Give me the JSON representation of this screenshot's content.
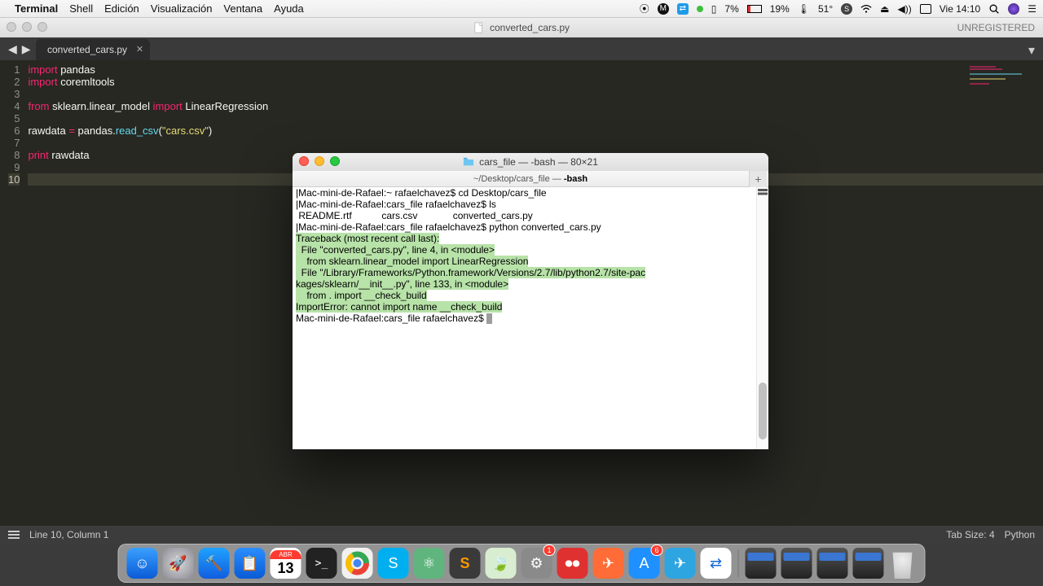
{
  "menubar": {
    "app": "Terminal",
    "items": [
      "Shell",
      "Edición",
      "Visualización",
      "Ventana",
      "Ayuda"
    ],
    "right": {
      "cpu": "7%",
      "battery": "19%",
      "temp": "51°",
      "clock": "Vie 14:10"
    }
  },
  "sublime": {
    "title_file": "converted_cars.py",
    "unregistered": "UNREGISTERED",
    "tab": "converted_cars.py",
    "lines": [
      "1",
      "2",
      "3",
      "4",
      "5",
      "6",
      "7",
      "8",
      "9",
      "10"
    ],
    "cursor_line": "10",
    "code": {
      "l1_kw": "import",
      "l1_rest": " pandas",
      "l2_kw": "import",
      "l2_rest": " coremltools",
      "l4_from": "from",
      "l4_mod": " sklearn.linear_model ",
      "l4_imp": "import",
      "l4_rest": " LinearRegression",
      "l6_a": "rawdata ",
      "l6_eq": "=",
      "l6_b": " pandas.",
      "l6_fn": "read_csv",
      "l6_p1": "(",
      "l6_str": "\"cars.csv\"",
      "l6_p2": ")",
      "l8_kw": "print",
      "l8_rest": " rawdata"
    },
    "status": {
      "pos": "Line 10, Column 1",
      "tabsize": "Tab Size: 4",
      "syntax": "Python"
    }
  },
  "terminal": {
    "title": "cars_file — -bash — 80×21",
    "pathbar_a": "~/Desktop/cars_file — ",
    "pathbar_b": "-bash",
    "lines": [
      "|Mac-mini-de-Rafael:~ rafaelchavez$ cd Desktop/cars_file",
      "|Mac-mini-de-Rafael:cars_file rafaelchavez$ ls",
      " README.rtf           cars.csv             converted_cars.py",
      "|Mac-mini-de-Rafael:cars_file rafaelchavez$ python converted_cars.py"
    ],
    "err": [
      "Traceback (most recent call last):",
      "  File \"converted_cars.py\", line 4, in <module>",
      "    from sklearn.linear_model import LinearRegression",
      "  File \"/Library/Frameworks/Python.framework/Versions/2.7/lib/python2.7/site-pac",
      "kages/sklearn/__init__.py\", line 133, in <module>",
      "    from . import __check_build",
      "ImportError: cannot import name __check_build"
    ],
    "prompt": "Mac-mini-de-Rafael:cars_file rafaelchavez$ "
  },
  "dock": {
    "apps": [
      {
        "name": "finder",
        "bg": "linear-gradient(#3aa0ff,#0a5bd6)",
        "glyph": "☺"
      },
      {
        "name": "launchpad",
        "bg": "radial-gradient(#d7d7d7,#8a8a95)",
        "glyph": "🚀"
      },
      {
        "name": "xcode",
        "bg": "linear-gradient(#1fa2ff,#115ddf)",
        "glyph": "🔨"
      },
      {
        "name": "trello",
        "bg": "linear-gradient(#2b8eff,#0a5bd6)",
        "glyph": "📋"
      },
      {
        "name": "calendar",
        "bg": "#fff",
        "glyph": "",
        "cal": "13",
        "month": "ABR"
      },
      {
        "name": "terminal",
        "bg": "#222",
        "glyph": ">_"
      },
      {
        "name": "chrome",
        "bg": "#f1f1f1",
        "glyph": "◉",
        "ring": true
      },
      {
        "name": "skype",
        "bg": "#00aff0",
        "glyph": "S"
      },
      {
        "name": "atom",
        "bg": "#5fb57d",
        "glyph": "⚛"
      },
      {
        "name": "sublime",
        "bg": "#3a3a3a",
        "glyph": "S",
        "accent": "#ff9900"
      },
      {
        "name": "mongodb",
        "bg": "#d9edd0",
        "glyph": "🍃"
      },
      {
        "name": "settings",
        "bg": "#8a8a8a",
        "glyph": "⚙",
        "badge": "1"
      },
      {
        "name": "recorder",
        "bg": "#e03131",
        "glyph": "⏺⏺"
      },
      {
        "name": "postman",
        "bg": "#ff6c37",
        "glyph": "✈"
      },
      {
        "name": "appstore",
        "bg": "#1e90ff",
        "glyph": "A",
        "badge": "6"
      },
      {
        "name": "telegram",
        "bg": "#2da5e1",
        "glyph": "✈"
      },
      {
        "name": "teamviewer",
        "bg": "#fff",
        "glyph": "⇄",
        "accent": "#1266d8"
      }
    ]
  }
}
